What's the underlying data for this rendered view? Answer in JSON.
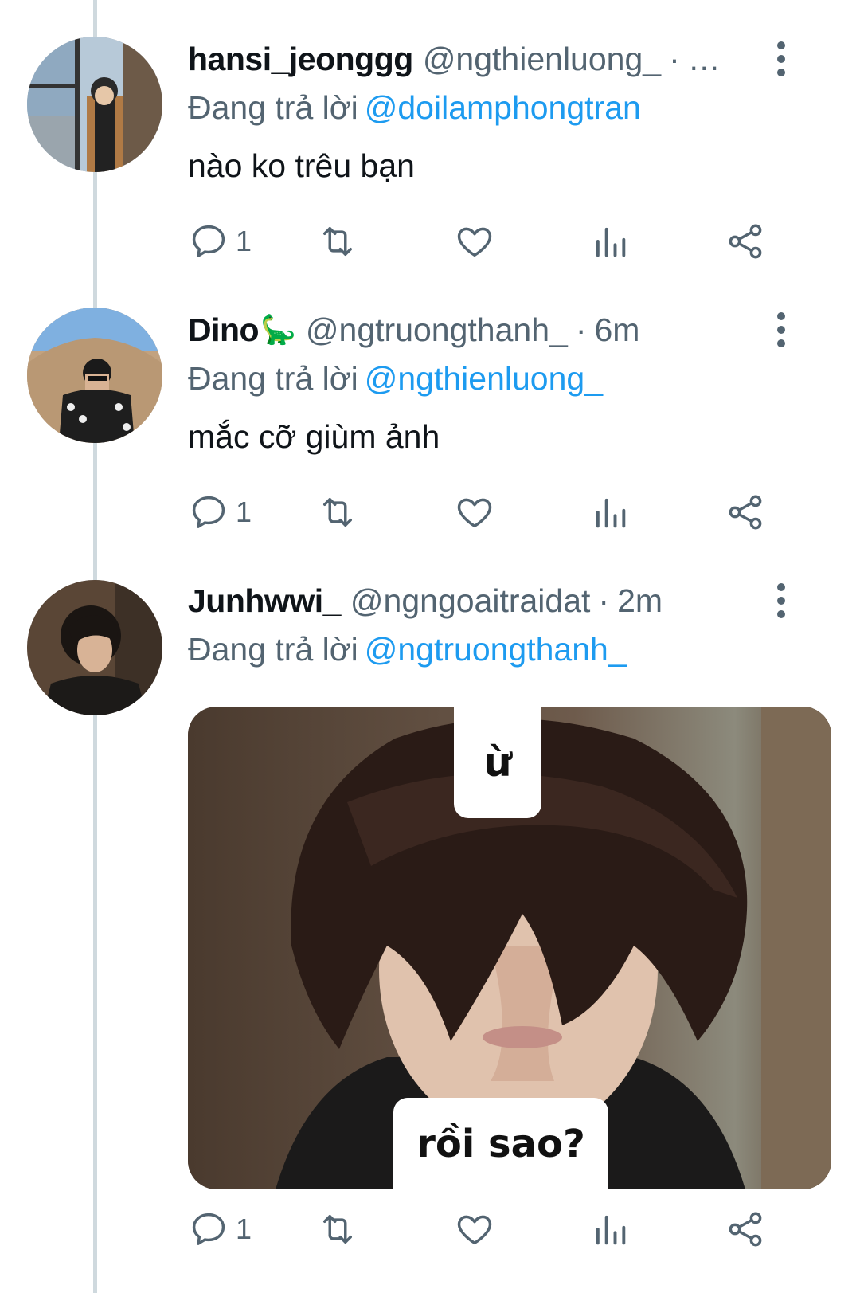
{
  "tweets": [
    {
      "display_name": "hansi_jeonggg",
      "name_emoji": "",
      "handle": "@ngthienluong_",
      "separator": "·",
      "time": "…",
      "reply_prefix": "Đang trả lời",
      "reply_to": "@doilamphongtran",
      "text": "nào ko trêu bạn",
      "reply_count": "1"
    },
    {
      "display_name": "Dino",
      "name_emoji": "🦕",
      "handle": "@ngtruongthanh_",
      "separator": "·",
      "time": "6m",
      "reply_prefix": "Đang trả lời",
      "reply_to": "@ngthienluong_",
      "text": "mắc cỡ giùm ảnh",
      "reply_count": "1"
    },
    {
      "display_name": "Junhwwi_",
      "name_emoji": "",
      "handle": "@ngngoaitraidat",
      "separator": "·",
      "time": "2m",
      "reply_prefix": "Đang trả lời",
      "reply_to": "@ngtruongthanh_",
      "text": "",
      "reply_count": "1",
      "media": {
        "caption_top": "ừ",
        "caption_bottom": "rồi sao?"
      }
    }
  ],
  "icons": {
    "reply": "reply-bubble-icon",
    "retweet": "retweet-icon",
    "like": "heart-icon",
    "views": "views-bar-chart-icon",
    "share": "share-icon",
    "more": "more-vertical-icon"
  },
  "colors": {
    "link": "#1d9bf0",
    "secondary": "#536471",
    "primary": "#0f1419",
    "thread_line": "#cfd9de"
  }
}
